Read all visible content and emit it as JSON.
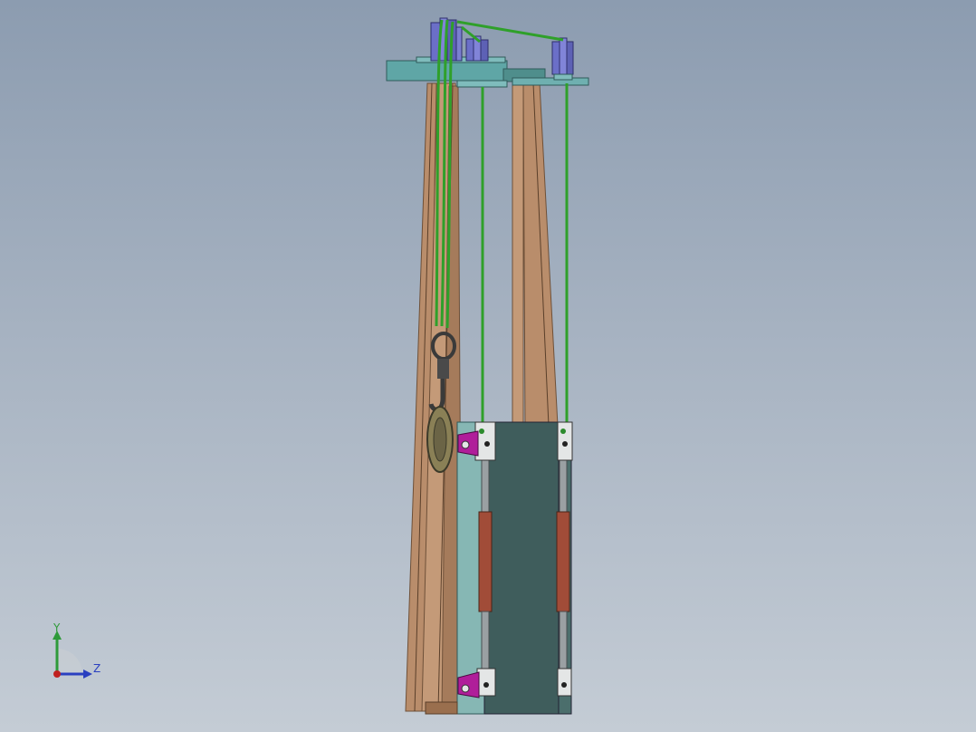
{
  "viewport": {
    "background_top": "#8c9cb0",
    "background_bottom": "#c4ccd5"
  },
  "model": {
    "colors": {
      "wood": "#b98d6b",
      "wood_dark": "#8e6a4c",
      "rope": "#2fa02a",
      "plate_teal": "#5fa6a6",
      "panel_dark": "#3f5d5c",
      "panel_light": "#86b7b4",
      "sheave": "#6b6fc8",
      "clamp": "#b01e9a",
      "cylinder": "#a14c38",
      "rod": "#9aa0a3"
    }
  },
  "triad": {
    "y_label": "Y",
    "z_label": "Z",
    "colors": {
      "y": "#2e9a3a",
      "z": "#2a3fc0",
      "x": "#c02020"
    }
  }
}
